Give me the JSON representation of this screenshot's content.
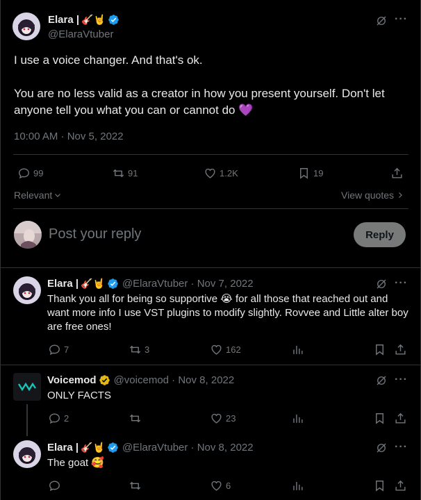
{
  "main_post": {
    "author_name": "Elara |",
    "author_emoji": "🎸🤘",
    "handle": "@ElaraVtuber",
    "text_line1": "I use a voice changer. And that's ok.",
    "text_line2": "You are no less valid as a creator in how you present yourself.  Don't let anyone tell you what you can or cannot do 💜",
    "timestamp": "10:00 AM · Nov 5, 2022",
    "replies": "99",
    "reposts": "91",
    "likes": "1.2K",
    "bookmarks": "19"
  },
  "sort": {
    "label": "Relevant",
    "view_quotes": "View quotes"
  },
  "composer": {
    "placeholder": "Post your reply",
    "button": "Reply"
  },
  "replies": [
    {
      "author_name": "Elara |",
      "author_emoji": "🎸🤘",
      "handle_date": "@ElaraVtuber · Nov 7, 2022",
      "text": "Thank you all for being so supportive 😭 for all those that reached out and want more info I use VST plugins to modify slightly. Rovvee and Little alter boy are free ones!",
      "replies": "7",
      "reposts": "3",
      "likes": "162"
    },
    {
      "author_name": "Voicemod",
      "handle_date": "@voicemod · Nov 8, 2022",
      "text": "ONLY FACTS",
      "replies": "2",
      "reposts": "",
      "likes": "23"
    },
    {
      "author_name": "Elara |",
      "author_emoji": "🎸🤘",
      "handle_date": "@ElaraVtuber · Nov 8, 2022",
      "text": "The goat 🥰",
      "replies": "",
      "reposts": "",
      "likes": "6"
    }
  ],
  "colors": {
    "background": "#000000",
    "text": "#e7e9ea",
    "muted": "#71767b",
    "verified_blue": "#1d9bf0",
    "verified_gold": "#e2b719",
    "heart_purple": "#aa8ed6",
    "reply_button": "#787a7a"
  },
  "icons": [
    "reply-icon",
    "repost-icon",
    "like-icon",
    "bookmark-icon",
    "share-icon",
    "views-icon",
    "grok-icon",
    "more-icon",
    "verified-badge-icon",
    "chevron-down-icon",
    "chevron-right-icon"
  ]
}
